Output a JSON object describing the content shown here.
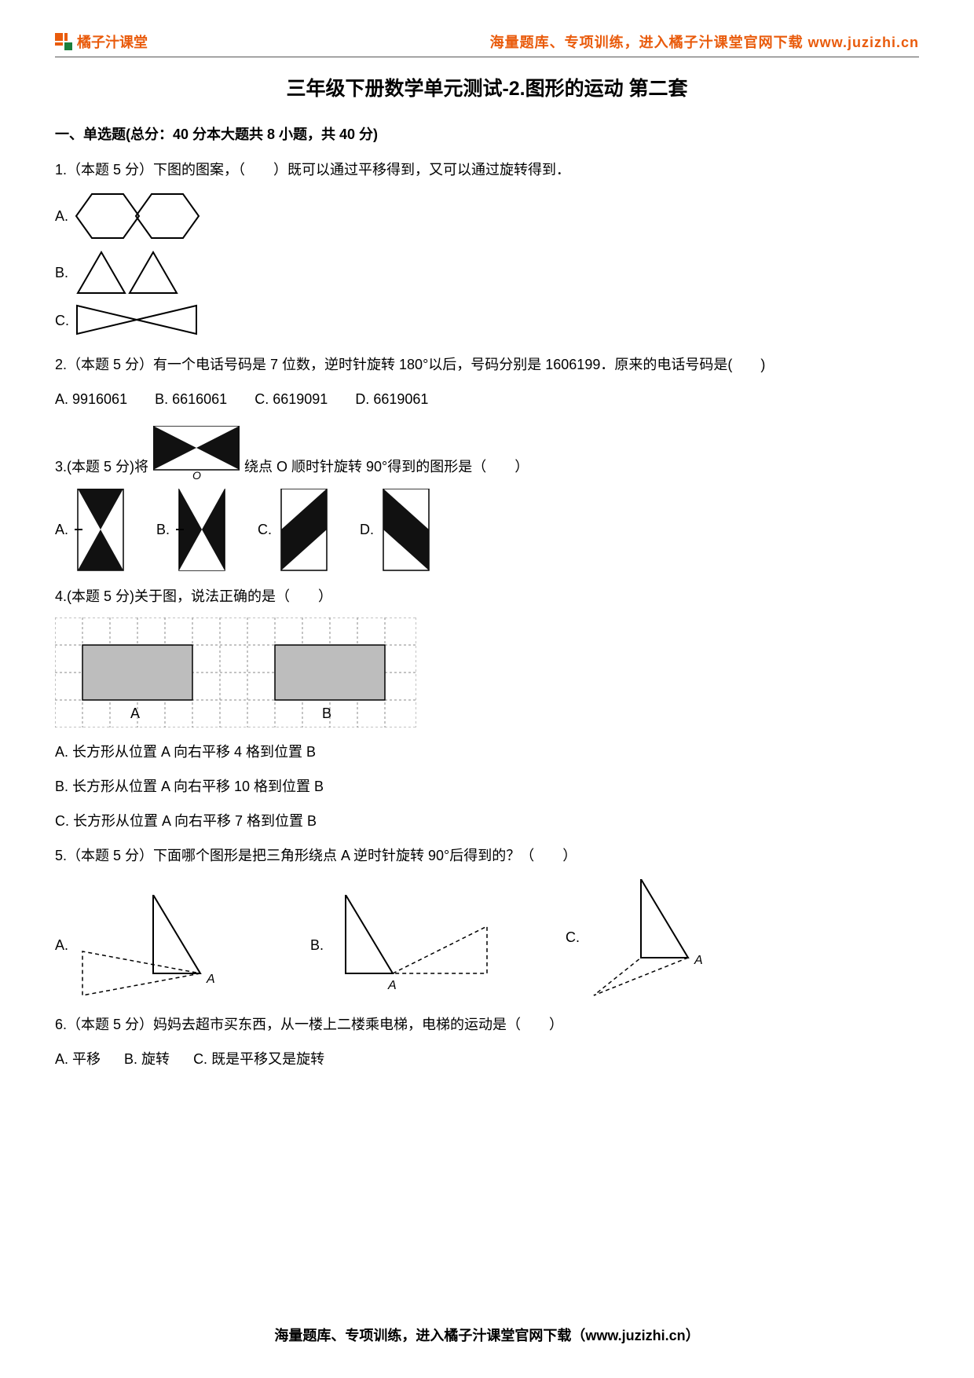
{
  "header": {
    "brand": "橘子汁课堂",
    "tagline": "海量题库、专项训练，进入橘子汁课堂官网下载 www.juzizhi.cn"
  },
  "title": "三年级下册数学单元测试-2.图形的运动  第二套",
  "section1": {
    "heading": "一、单选题(总分：40 分本大题共 8 小题，共 40 分)"
  },
  "q1": {
    "text": "1.（本题 5 分）下图的图案，（　　）既可以通过平移得到，又可以通过旋转得到．",
    "A": "A.",
    "B": "B.",
    "C": "C."
  },
  "q2": {
    "text": "2.（本题 5 分）有一个电话号码是 7 位数，逆时针旋转 180°以后，号码分别是 1606199．原来的电话号码是(　　)",
    "opts": {
      "A": "A. 9916061",
      "B": "B. 6616061",
      "C": "C. 6619091",
      "D": "D. 6619061"
    }
  },
  "q3": {
    "pre": "3.(本题 5 分)将",
    "post": "绕点 O 顺时针旋转 90°得到的图形是（　　）",
    "A": "A.",
    "B": "B.",
    "C": "C.",
    "D": "D.",
    "pivot": "O"
  },
  "q4": {
    "text": "4.(本题 5 分)关于图，说法正确的是（　　）",
    "labelA": "A",
    "labelB": "B",
    "opts": {
      "A": "A. 长方形从位置 A 向右平移 4 格到位置 B",
      "B": "B. 长方形从位置 A 向右平移 10 格到位置 B",
      "C": "C. 长方形从位置 A 向右平移 7 格到位置 B"
    }
  },
  "q5": {
    "text": "5.（本题 5 分）下面哪个图形是把三角形绕点 A 逆时针旋转 90°后得到的？（　　）",
    "A": "A.",
    "B": "B.",
    "C": "C.",
    "ptA": "A"
  },
  "q6": {
    "text": "6.（本题 5 分）妈妈去超市买东西，从一楼上二楼乘电梯，电梯的运动是（　　）",
    "opts": {
      "A": "A. 平移",
      "B": "B. 旋转",
      "C": "C. 既是平移又是旋转"
    }
  },
  "footer": "海量题库、专项训练，进入橘子汁课堂官网下载（www.juzizhi.cn）"
}
